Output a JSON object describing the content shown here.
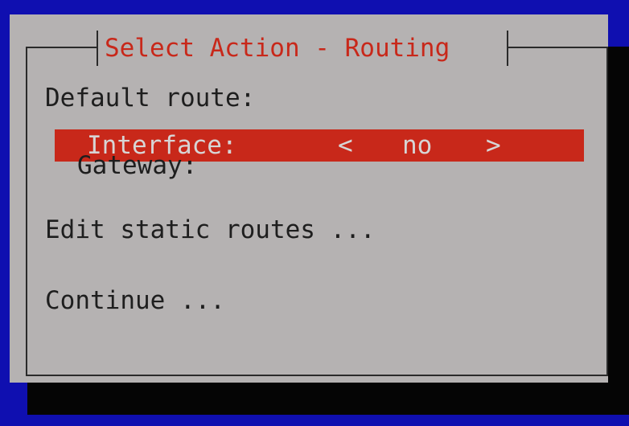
{
  "dialog": {
    "title": "Select Action - Routing"
  },
  "routing": {
    "default_route_label": "Default route:",
    "interface_label": "Interface:",
    "interface_left_arrow": "<",
    "interface_value": "no",
    "interface_right_arrow": ">",
    "gateway_label": "Gateway:",
    "edit_static_routes": "Edit static routes ...",
    "continue": "Continue ..."
  },
  "colors": {
    "background": "#0f0fb0",
    "dialog": "#b5b2b2",
    "shadow": "#050505",
    "accent": "#c8281a",
    "text": "#1e1e1e",
    "selected_text": "#d7d5d5"
  }
}
